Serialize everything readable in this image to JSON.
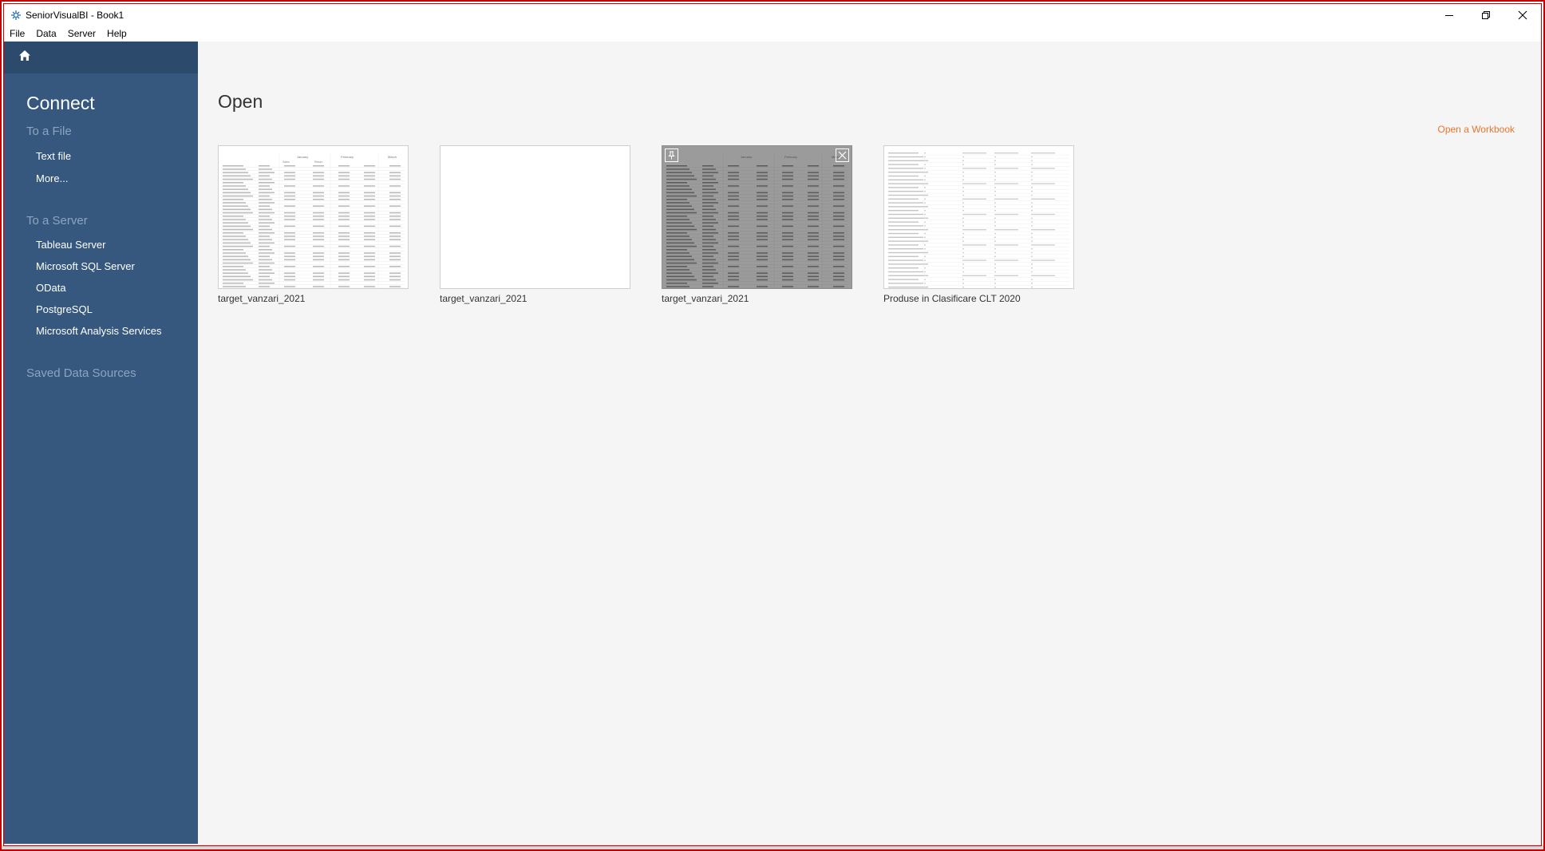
{
  "window": {
    "title": "SeniorVisualBI - Book1"
  },
  "menu": [
    "File",
    "Data",
    "Server",
    "Help"
  ],
  "sidebar": {
    "connect_title": "Connect",
    "to_file_heading": "To a File",
    "file_items": [
      "Text file",
      "More..."
    ],
    "to_server_heading": "To a Server",
    "server_items": [
      "Tableau Server",
      "Microsoft SQL Server",
      "OData",
      "PostgreSQL",
      "Microsoft Analysis Services"
    ],
    "saved_heading": "Saved Data Sources"
  },
  "main": {
    "open_title": "Open",
    "open_workbook_link": "Open a Workbook",
    "workbooks": [
      {
        "name": "target_vanzari_2021",
        "preview": "table"
      },
      {
        "name": "target_vanzari_2021",
        "preview": "blank"
      },
      {
        "name": "target_vanzari_2021",
        "preview": "table-hover"
      },
      {
        "name": "Produse in Clasificare CLT 2020",
        "preview": "list"
      }
    ],
    "thumb_header": {
      "month1": "January",
      "month2": "February",
      "month3": "March",
      "sub1": "Sales",
      "sub2": "Return"
    }
  },
  "colors": {
    "sidebar": "#36587e",
    "home_bar": "#2c4a6b",
    "accent_link": "#e8762b",
    "frame": "#c40000"
  },
  "icons": {
    "home": "home-icon",
    "app": "app-logo-icon",
    "minimize": "minimize-icon",
    "restore": "restore-icon",
    "close": "close-icon",
    "pin": "pin-icon",
    "remove": "remove-icon"
  }
}
